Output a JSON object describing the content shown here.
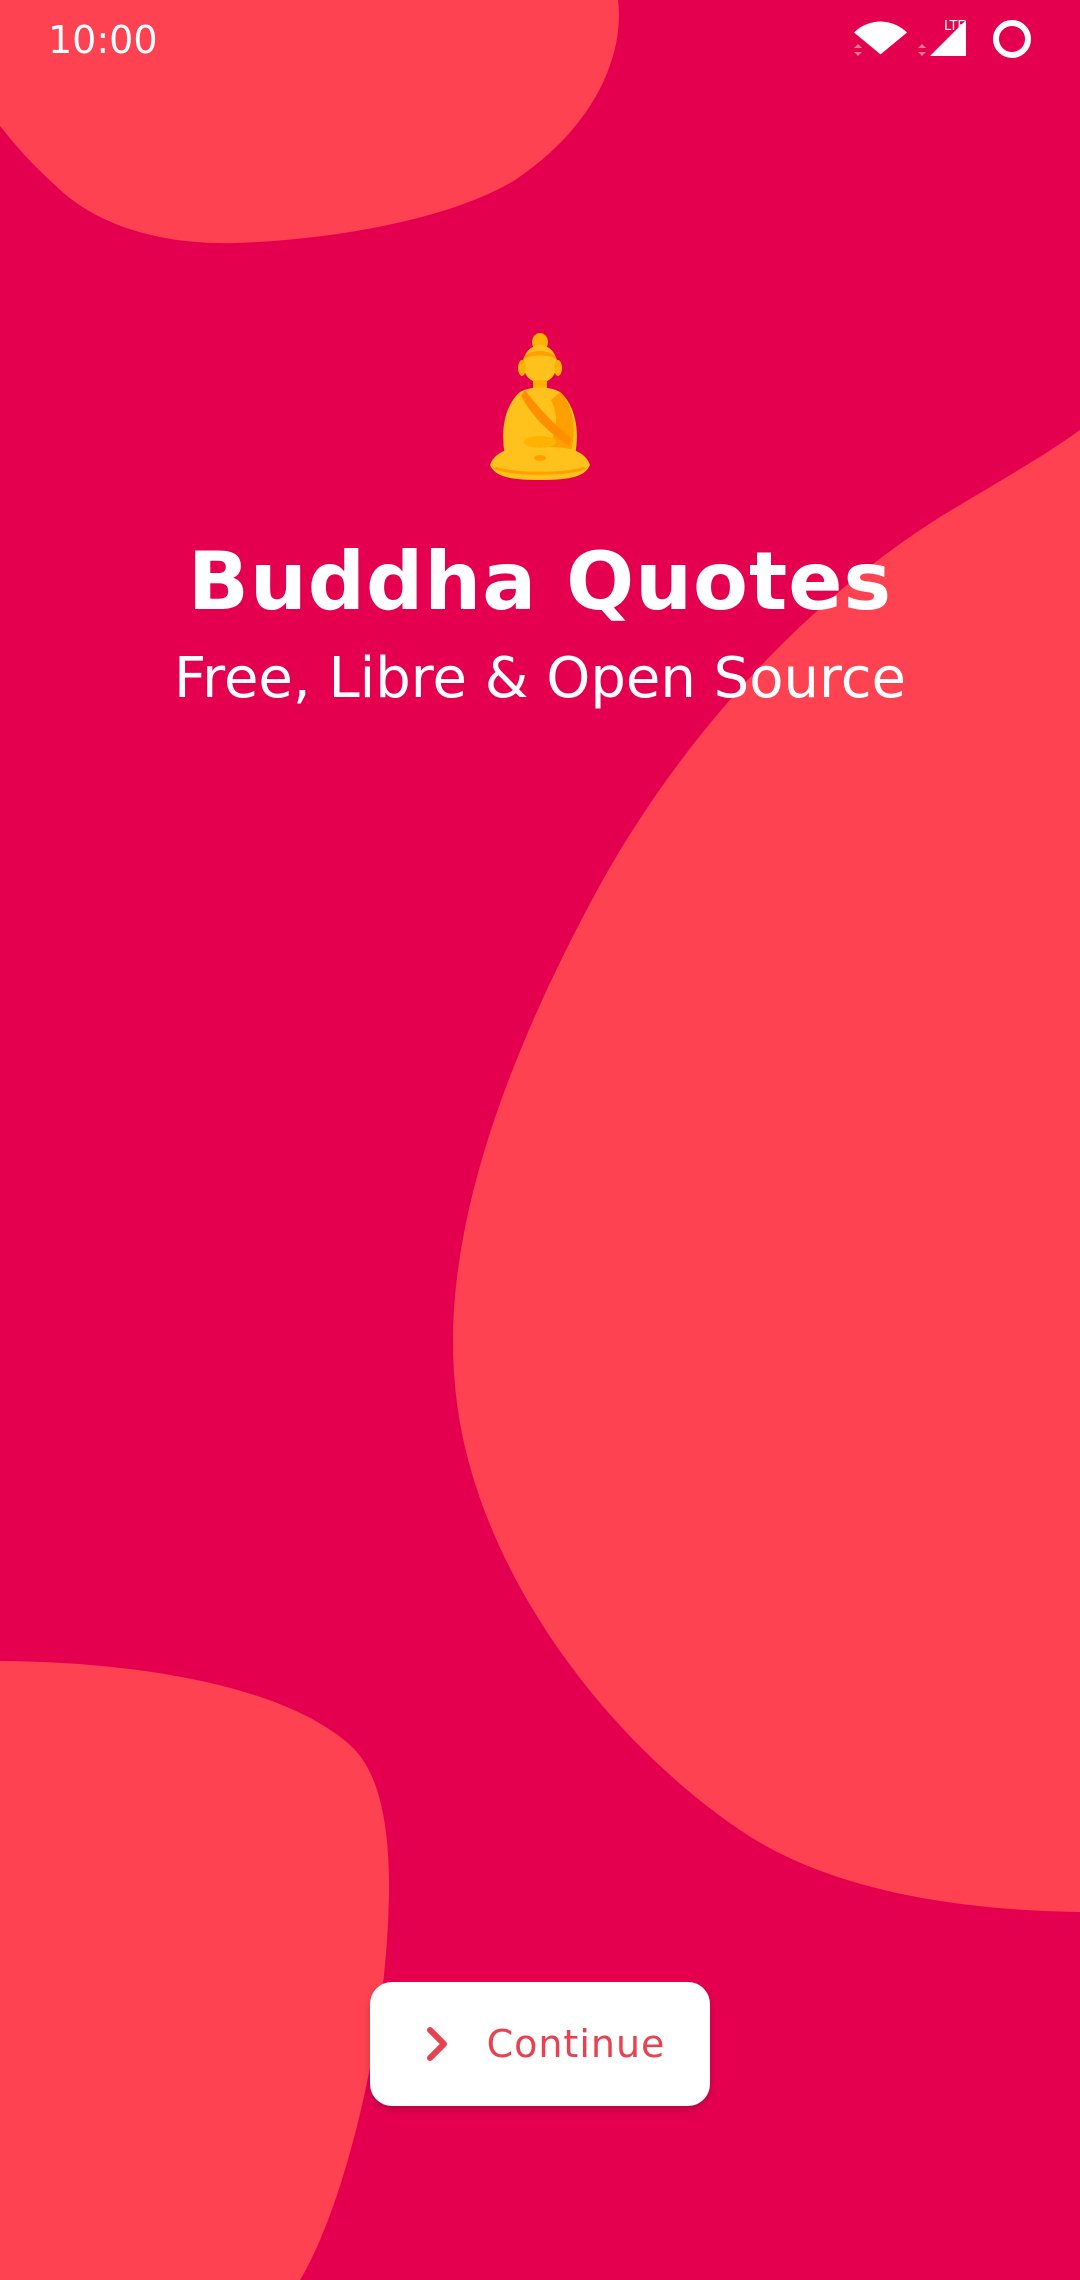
{
  "status_bar": {
    "time": "10:00",
    "network_label": "LTE",
    "icons": [
      "wifi-icon",
      "cell-signal-icon",
      "battery-ring-icon"
    ]
  },
  "app": {
    "title": "Buddha Quotes",
    "subtitle": "Free, Libre & Open Source",
    "logo_icon": "buddha-icon"
  },
  "actions": {
    "continue_label": "Continue",
    "continue_icon": "chevron-right-icon"
  },
  "colors": {
    "background": "#e5004f",
    "blob": "#ff4252",
    "button_background": "#ffffff",
    "button_text": "#e8414f",
    "logo_gold": "#ffc21c"
  }
}
